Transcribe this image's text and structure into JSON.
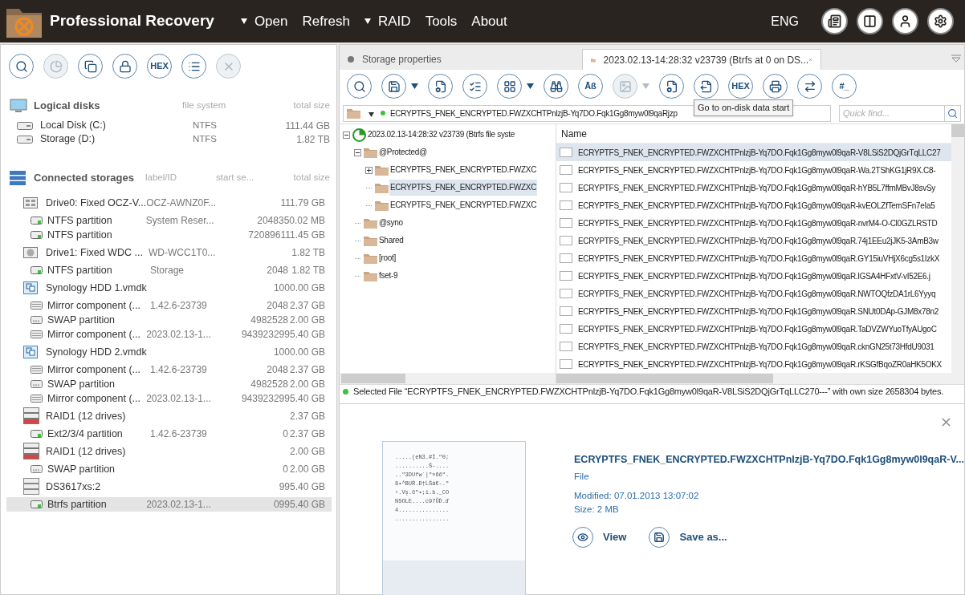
{
  "app": {
    "title": "Professional Recovery",
    "language": "ENG",
    "menu": [
      {
        "label": "Open",
        "has_dropdown": true
      },
      {
        "label": "Refresh",
        "has_dropdown": false
      },
      {
        "label": "RAID",
        "has_dropdown": true
      },
      {
        "label": "Tools",
        "has_dropdown": false
      },
      {
        "label": "About",
        "has_dropdown": false
      }
    ],
    "header_buttons": [
      {
        "kind": "log"
      },
      {
        "kind": "panel"
      },
      {
        "kind": "user"
      },
      {
        "kind": "settings"
      }
    ]
  },
  "left_toolbar": [
    {
      "kind": "search",
      "disabled": false
    },
    {
      "kind": "chart",
      "disabled": true
    },
    {
      "kind": "copy",
      "disabled": false
    },
    {
      "kind": "lock",
      "disabled": false
    },
    {
      "kind": "text",
      "label": "HEX",
      "disabled": false
    },
    {
      "kind": "list",
      "disabled": false
    },
    {
      "kind": "close",
      "disabled": true
    }
  ],
  "logical_disks": {
    "title": "Logical disks",
    "columns": [
      "file system",
      "total size"
    ],
    "items": [
      {
        "name": "Local Disk (C:)",
        "file_system": "NTFS",
        "size": "111.44 GB"
      },
      {
        "name": "Storage (D:)",
        "file_system": "NTFS",
        "size": "1.82 TB"
      }
    ]
  },
  "connected_storages": {
    "title": "Connected storages",
    "columns": [
      "label/ID",
      "start se...",
      "total size"
    ],
    "items": [
      {
        "kind": "ssd",
        "name": "Drive0: Fixed OCZ-V...",
        "label": "OCZ-AWNZ0F...",
        "size": "111.79 GB",
        "selected": false,
        "children": [
          {
            "kind": "partition",
            "name": "NTFS partition",
            "label": "System Reser...",
            "start": "2048",
            "size": "350.02 MB",
            "selected": false
          },
          {
            "kind": "partition",
            "name": "NTFS partition",
            "start": "720896",
            "size": "111.45 GB",
            "selected": false
          }
        ]
      },
      {
        "kind": "hdd",
        "name": "Drive1: Fixed WDC ...",
        "label": "WD-WCC1T0...",
        "size": "1.82 TB",
        "selected": false,
        "children": [
          {
            "kind": "partition",
            "name": "NTFS partition",
            "label": "Storage",
            "start": "2048",
            "size": "1.82 TB",
            "selected": false
          }
        ]
      },
      {
        "kind": "vmdk",
        "name": "Synology HDD 1.vmdk",
        "size": "1000.00 GB",
        "selected": false,
        "children": [
          {
            "kind": "mirror",
            "name": "Mirror component (...",
            "label": "1.42.6-23739",
            "start": "2048",
            "size": "2.37 GB",
            "selected": false
          },
          {
            "kind": "swap",
            "name": "SWAP partition",
            "start": "4982528",
            "size": "2.00 GB",
            "selected": false
          },
          {
            "kind": "mirror",
            "name": "Mirror component (...",
            "label": "2023.02.13-1...",
            "start": "9439232",
            "size": "995.40 GB",
            "selected": false
          }
        ]
      },
      {
        "kind": "vmdk",
        "name": "Synology HDD 2.vmdk",
        "size": "1000.00 GB",
        "selected": false,
        "children": [
          {
            "kind": "mirror",
            "name": "Mirror component (...",
            "label": "1.42.6-23739",
            "start": "2048",
            "size": "2.37 GB",
            "selected": false
          },
          {
            "kind": "swap",
            "name": "SWAP partition",
            "start": "4982528",
            "size": "2.00 GB",
            "selected": false
          },
          {
            "kind": "mirror",
            "name": "Mirror component (...",
            "label": "2023.02.13-1...",
            "start": "9439232",
            "size": "995.40 GB",
            "selected": false
          }
        ]
      },
      {
        "kind": "raid",
        "name": "RAID1 (12 drives)",
        "size": "2.37 GB",
        "selected": false,
        "children": [
          {
            "kind": "partition",
            "name": "Ext2/3/4 partition",
            "label": "1.42.6-23739",
            "start": "0",
            "size": "2.37 GB",
            "selected": false
          }
        ]
      },
      {
        "kind": "raid",
        "name": "RAID1 (12 drives)",
        "size": "2.00 GB",
        "selected": false,
        "children": [
          {
            "kind": "swap",
            "name": "SWAP partition",
            "start": "0",
            "size": "2.00 GB",
            "selected": false
          }
        ]
      },
      {
        "kind": "nas",
        "name": "DS3617xs:2",
        "size": "995.40 GB",
        "selected": false,
        "children": [
          {
            "kind": "partition",
            "name": "Btrfs partition",
            "label": "2023.02.13-1...",
            "start": "0",
            "size": "995.40 GB",
            "selected": true
          }
        ]
      }
    ]
  },
  "tabs": [
    {
      "label": "Storage properties",
      "selected": false
    },
    {
      "label": "2023.02.13-14:28:32 v23739 (Btrfs at 0 on DS...",
      "selected": true
    }
  ],
  "toolbar": [
    {
      "kind": "search",
      "disabled": false
    },
    {
      "kind": "save",
      "disabled": false
    },
    {
      "kind": "caret",
      "disabled": false
    },
    {
      "kind": "file-settings",
      "disabled": false
    },
    {
      "kind": "checklist",
      "disabled": false
    },
    {
      "kind": "grid",
      "disabled": false
    },
    {
      "kind": "caret",
      "disabled": false
    },
    {
      "kind": "binoculars",
      "disabled": false
    },
    {
      "kind": "text",
      "label": "Āß",
      "disabled": false
    },
    {
      "kind": "image",
      "disabled": true
    },
    {
      "kind": "caret",
      "disabled": true
    },
    {
      "kind": "file-gear",
      "disabled": false
    },
    {
      "kind": "file-jump",
      "disabled": false
    },
    {
      "kind": "text",
      "label": "HEX",
      "disabled": false
    },
    {
      "kind": "printer",
      "disabled": false
    },
    {
      "kind": "export",
      "disabled": false
    },
    {
      "kind": "text",
      "label": "#_",
      "disabled": false
    }
  ],
  "tooltip": "Go to on-disk data start",
  "path": "ECRYPTFS_FNEK_ENCRYPTED.FWZXCHTPnlzjB-Yq7DO.Fqk1Gg8myw0l9qaRjzp",
  "quick_find": {
    "placeholder": "Quick find..."
  },
  "tree": {
    "label": "2023.02.13-14:28:32 v23739 (Btrfs file syste",
    "expanded": true,
    "selected": false,
    "children": [
      {
        "label": "@Protected@",
        "expanded": true,
        "selected": false,
        "children": [
          {
            "label": "ECRYPTFS_FNEK_ENCRYPTED.FWZXC",
            "expanded": false,
            "has_children": true,
            "selected": false
          },
          {
            "label": "ECRYPTFS_FNEK_ENCRYPTED.FWZXC",
            "selected": true
          },
          {
            "label": "ECRYPTFS_FNEK_ENCRYPTED.FWZXC",
            "selected": false
          }
        ]
      },
      {
        "label": "@syno",
        "selected": false
      },
      {
        "label": "Shared",
        "selected": false
      },
      {
        "label": "[root]",
        "selected": false
      },
      {
        "label": "fset-9",
        "selected": false
      }
    ]
  },
  "file_list": {
    "column": "Name",
    "rows": [
      {
        "name": "ECRYPTFS_FNEK_ENCRYPTED.FWZXCHTPnlzjB-Yq7DO.Fqk1Gg8myw0l9qaR-V8LSiS2DQjGrTqLLC27",
        "selected": true
      },
      {
        "name": "ECRYPTFS_FNEK_ENCRYPTED.FWZXCHTPnlzjB-Yq7DO.Fqk1Gg8myw0l9qaR-Wa.2TShKG1jR9X.C8-",
        "selected": false
      },
      {
        "name": "ECRYPTFS_FNEK_ENCRYPTED.FWZXCHTPnlzjB-Yq7DO.Fqk1Gg8myw0l9qaR-hYB5L7ffmMBvJ8svSy",
        "selected": false
      },
      {
        "name": "ECRYPTFS_FNEK_ENCRYPTED.FWZXCHTPnlzjB-Yq7DO.Fqk1Gg8myw0l9qaR-kvEOLZfTemSFn7eIa5",
        "selected": false
      },
      {
        "name": "ECRYPTFS_FNEK_ENCRYPTED.FWZXCHTPnlzjB-Yq7DO.Fqk1Gg8myw0l9qaR-nvrM4-O-Cl0GZLRSTD",
        "selected": false
      },
      {
        "name": "ECRYPTFS_FNEK_ENCRYPTED.FWZXCHTPnlzjB-Yq7DO.Fqk1Gg8myw0l9qaR.74j1EEu2jJK5-3AmB3w",
        "selected": false
      },
      {
        "name": "ECRYPTFS_FNEK_ENCRYPTED.FWZXCHTPnlzjB-Yq7DO.Fqk1Gg8myw0l9qaR.GY15iuVHjX6cg5s1IzkX",
        "selected": false
      },
      {
        "name": "ECRYPTFS_FNEK_ENCRYPTED.FWZXCHTPnlzjB-Yq7DO.Fqk1Gg8myw0l9qaR.IGSA4HFxtV-vI52E6.j",
        "selected": false
      },
      {
        "name": "ECRYPTFS_FNEK_ENCRYPTED.FWZXCHTPnlzjB-Yq7DO.Fqk1Gg8myw0l9qaR.NWTOQfzDA1rL6Yyyq",
        "selected": false
      },
      {
        "name": "ECRYPTFS_FNEK_ENCRYPTED.FWZXCHTPnlzjB-Yq7DO.Fqk1Gg8myw0l9qaR.SNUt0DAp-GJM8x78n2",
        "selected": false
      },
      {
        "name": "ECRYPTFS_FNEK_ENCRYPTED.FWZXCHTPnlzjB-Yq7DO.Fqk1Gg8myw0l9qaR.TaDVZWYuoTfyAUgoC",
        "selected": false
      },
      {
        "name": "ECRYPTFS_FNEK_ENCRYPTED.FWZXCHTPnlzjB-Yq7DO.Fqk1Gg8myw0l9qaR.cknGN25t73HfdU9031",
        "selected": false
      },
      {
        "name": "ECRYPTFS_FNEK_ENCRYPTED.FWZXCHTPnlzjB-Yq7DO.Fqk1Gg8myw0l9qaR.rKSGfBqoZR0aHK5OKX",
        "selected": false
      }
    ]
  },
  "status": "Selected File “ECRYPTFS_FNEK_ENCRYPTED.FWZXCHTPnlzjB-Yq7DO.Fqk1Gg8myw0l9qaR-V8LSiS2DQjGrTqLLC270---” with own size 2658304 bytes.",
  "preview": {
    "name": "ECRYPTFS_FNEK_ENCRYPTED.FWZXCHTPnlzjB-Yq7DO.Fqk1Gg8myw0l9qaR-V...",
    "type": "File",
    "modified": "Modified: 07.01.2013 13:07:02",
    "size": "Size: 2 MB",
    "thumbnail_lines": [
      ".....(eN3.#Î.\"0;",
      "..........Š-....",
      "..\"3DUfw`|\"»6ő\".",
      "8•^BUŘ.Đ†ĹŠá€-.\"",
      "‹.Vş.ő\"•;i.b._CO",
      "NSOLE....c97ŬĎ.ď",
      "4...............",
      "................"
    ],
    "actions": [
      {
        "kind": "view",
        "label": "View"
      },
      {
        "kind": "save",
        "label": "Save as..."
      }
    ]
  }
}
